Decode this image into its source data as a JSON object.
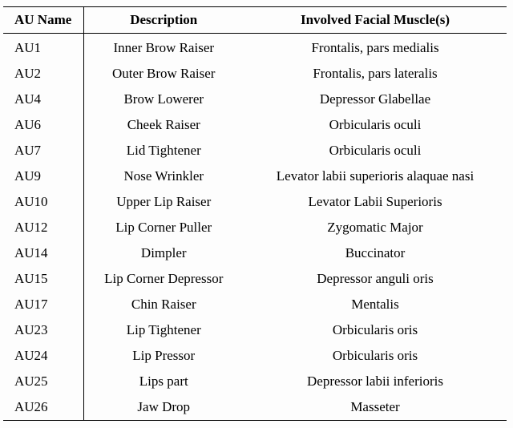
{
  "table": {
    "headers": [
      "AU Name",
      "Description",
      "Involved Facial Muscle(s)"
    ],
    "rows": [
      {
        "au": "AU1",
        "desc": "Inner Brow Raiser",
        "muscle": "Frontalis, pars medialis"
      },
      {
        "au": "AU2",
        "desc": "Outer Brow Raiser",
        "muscle": "Frontalis, pars lateralis"
      },
      {
        "au": "AU4",
        "desc": "Brow Lowerer",
        "muscle": "Depressor Glabellae"
      },
      {
        "au": "AU6",
        "desc": "Cheek Raiser",
        "muscle": "Orbicularis oculi"
      },
      {
        "au": "AU7",
        "desc": "Lid Tightener",
        "muscle": "Orbicularis oculi"
      },
      {
        "au": "AU9",
        "desc": "Nose Wrinkler",
        "muscle": "Levator labii superioris alaquae nasi"
      },
      {
        "au": "AU10",
        "desc": "Upper Lip Raiser",
        "muscle": "Levator Labii Superioris"
      },
      {
        "au": "AU12",
        "desc": "Lip Corner Puller",
        "muscle": "Zygomatic Major"
      },
      {
        "au": "AU14",
        "desc": "Dimpler",
        "muscle": "Buccinator"
      },
      {
        "au": "AU15",
        "desc": "Lip Corner Depressor",
        "muscle": "Depressor anguli oris"
      },
      {
        "au": "AU17",
        "desc": "Chin Raiser",
        "muscle": "Mentalis"
      },
      {
        "au": "AU23",
        "desc": "Lip Tightener",
        "muscle": "Orbicularis oris"
      },
      {
        "au": "AU24",
        "desc": "Lip Pressor",
        "muscle": "Orbicularis oris"
      },
      {
        "au": "AU25",
        "desc": "Lips part",
        "muscle": "Depressor labii inferioris"
      },
      {
        "au": "AU26",
        "desc": "Jaw Drop",
        "muscle": "Masseter"
      }
    ]
  }
}
